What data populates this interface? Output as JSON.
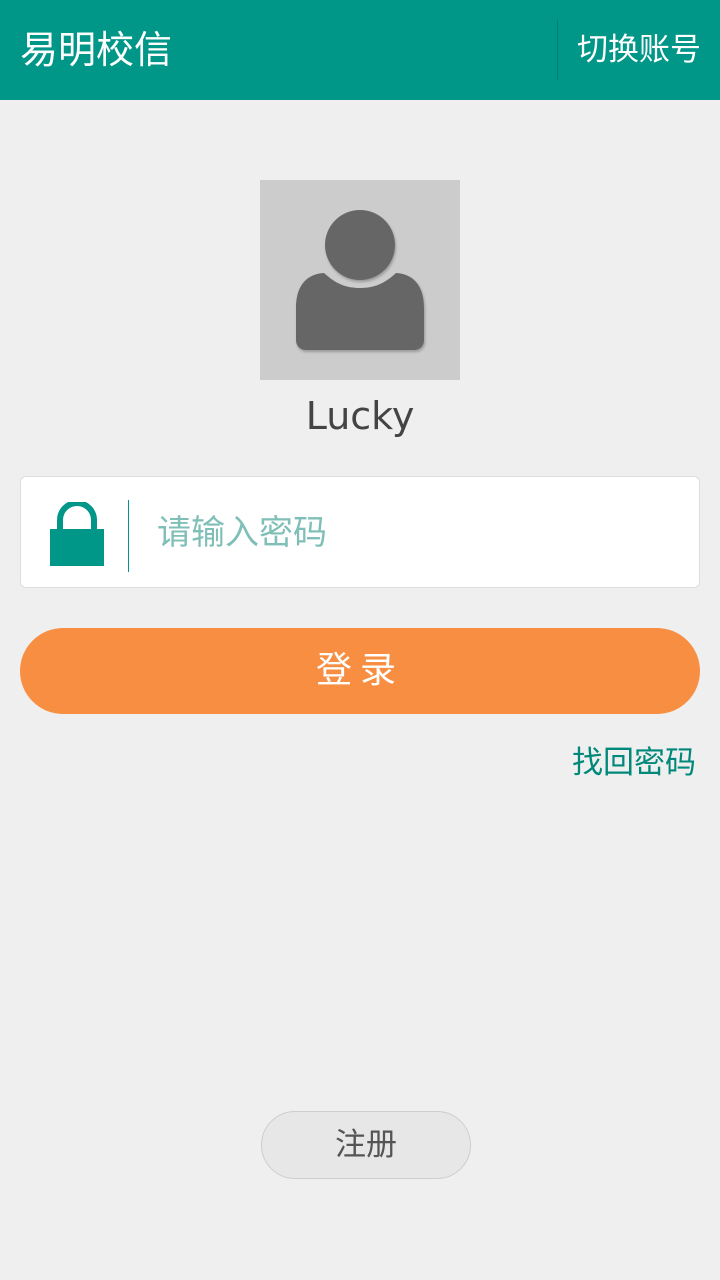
{
  "header": {
    "title": "易明校信",
    "switch_account_label": "切换账号"
  },
  "profile": {
    "avatar_icon": "default-user-icon",
    "username": "Lucky"
  },
  "password": {
    "icon": "lock-icon",
    "placeholder": "请输入密码",
    "value": ""
  },
  "actions": {
    "login_label": "登录",
    "forgot_password_label": "找回密码",
    "register_label": "注册"
  },
  "colors": {
    "primary": "#009688",
    "login_button": "#f78e42",
    "background": "#efefef"
  }
}
